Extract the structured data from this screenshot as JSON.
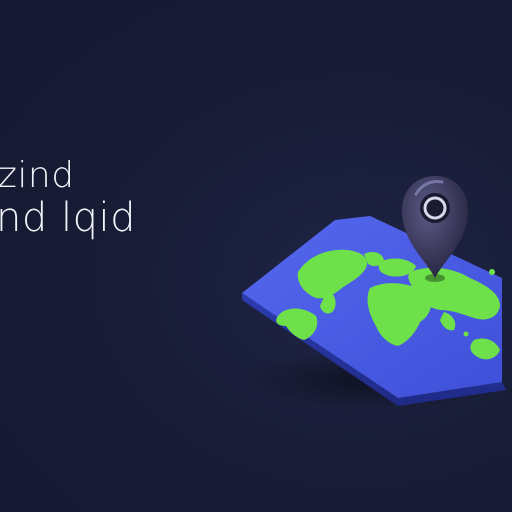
{
  "hero": {
    "title_line_1": "zind",
    "title_line_2": "nd lqid",
    "caption_line_1": "",
    "caption_line_2": ""
  },
  "illustration": {
    "icon": "map-pin-icon",
    "map": "world-map",
    "colors": {
      "background": "#171b34",
      "map_surface": "#4b5ee6",
      "land": "#6ee04a",
      "pin": "#2a2a4a"
    }
  }
}
